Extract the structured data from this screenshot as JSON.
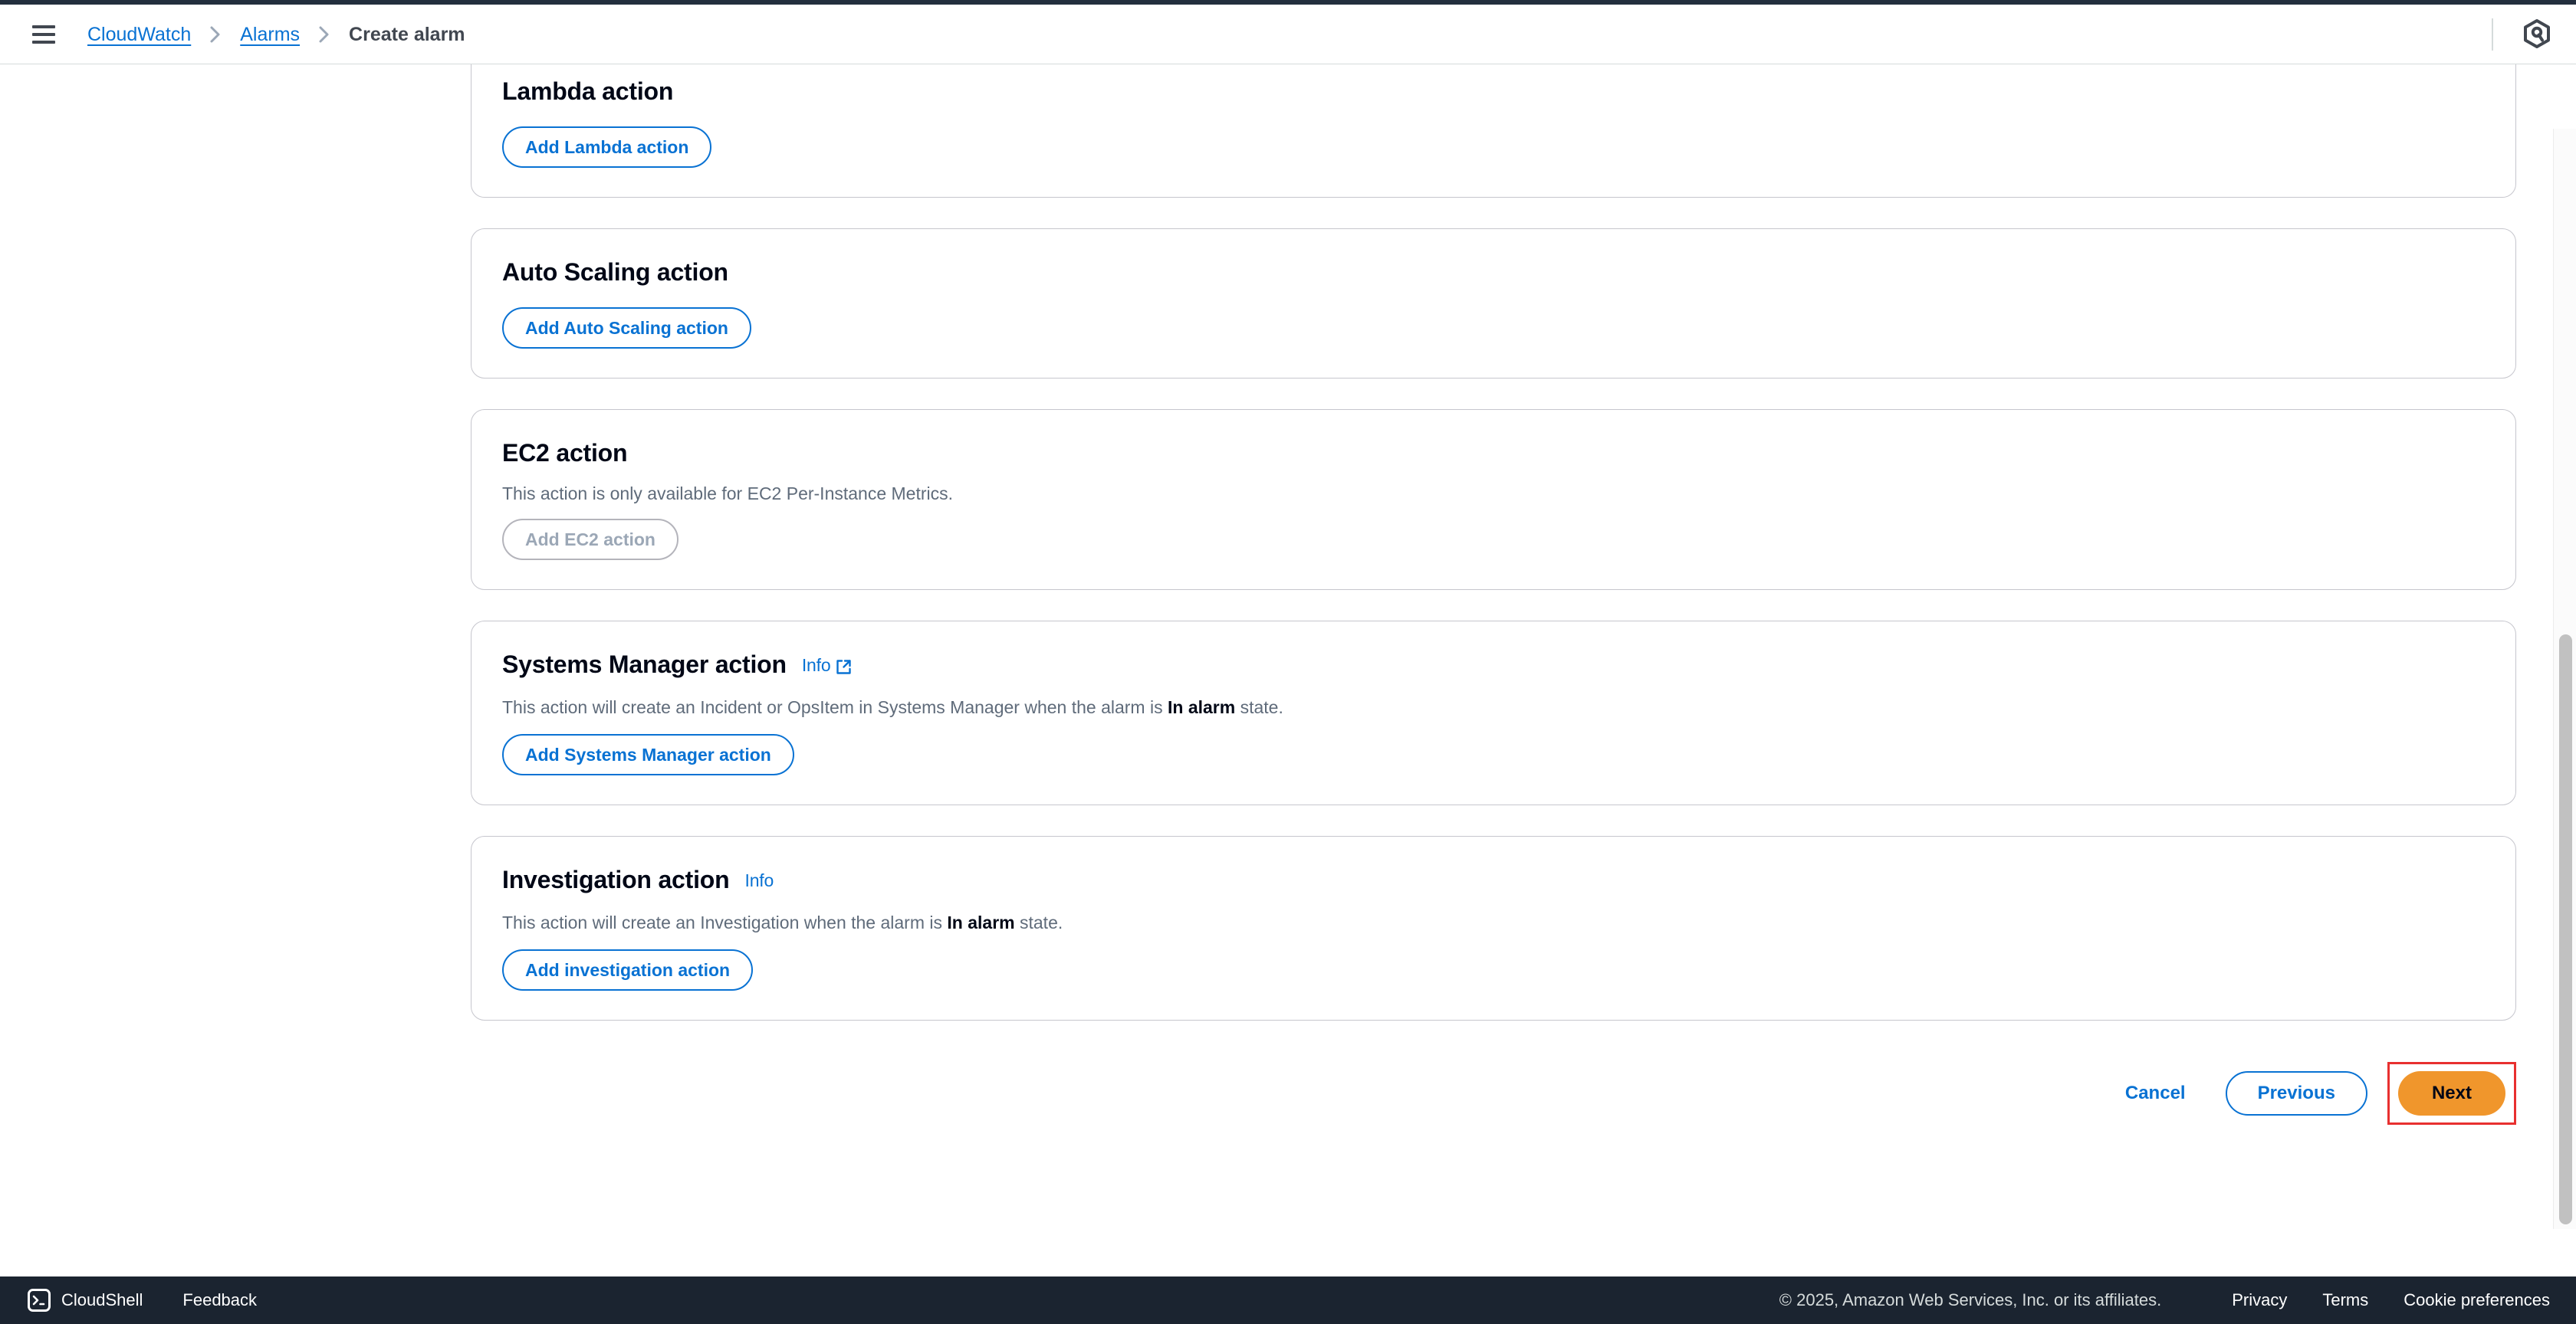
{
  "header": {
    "menu_icon": "hamburger-menu-icon",
    "breadcrumb": [
      {
        "label": "CloudWatch",
        "current": false
      },
      {
        "label": "Alarms",
        "current": false
      },
      {
        "label": "Create alarm",
        "current": true
      }
    ],
    "assistant_icon": "amazon-q-icon"
  },
  "cards": [
    {
      "id": "lambda-action",
      "title": "Lambda action",
      "info": null,
      "description": null,
      "button": {
        "label": "Add Lambda action",
        "disabled": false
      }
    },
    {
      "id": "auto-scaling-action",
      "title": "Auto Scaling action",
      "info": null,
      "description": null,
      "button": {
        "label": "Add Auto Scaling action",
        "disabled": false
      }
    },
    {
      "id": "ec2-action",
      "title": "EC2 action",
      "info": null,
      "description": "This action is only available for EC2 Per-Instance Metrics.",
      "button": {
        "label": "Add EC2 action",
        "disabled": true
      }
    },
    {
      "id": "systems-manager-action",
      "title": "Systems Manager action",
      "info": {
        "label": "Info",
        "external": true
      },
      "description_parts": [
        "This action will create an Incident or OpsItem in Systems Manager when the alarm is ",
        "In alarm",
        " state."
      ],
      "button": {
        "label": "Add Systems Manager action",
        "disabled": false
      }
    },
    {
      "id": "investigation-action",
      "title": "Investigation action",
      "info": {
        "label": "Info",
        "external": false
      },
      "description_parts": [
        "This action will create an Investigation when the alarm is ",
        "In alarm",
        " state."
      ],
      "button": {
        "label": "Add investigation action",
        "disabled": false
      }
    }
  ],
  "form_actions": {
    "cancel_label": "Cancel",
    "previous_label": "Previous",
    "next_label": "Next",
    "next_highlighted": true
  },
  "bottom_bar": {
    "cloudshell_label": "CloudShell",
    "cloudshell_icon": "terminal-icon",
    "feedback_label": "Feedback",
    "copyright": "© 2025, Amazon Web Services, Inc. or its affiliates.",
    "links": [
      "Privacy",
      "Terms",
      "Cookie preferences"
    ]
  },
  "colors": {
    "link_blue": "#0972d3",
    "primary_orange": "#f0962c",
    "highlight_red": "#e8302f",
    "dark_navy": "#1b2430",
    "card_border": "#c6c6cd"
  }
}
